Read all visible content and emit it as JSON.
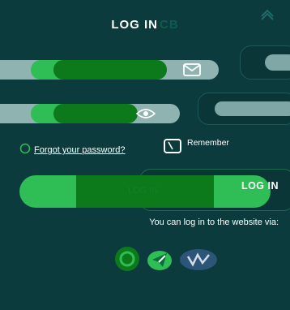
{
  "header": {
    "title": "LOG IN",
    "title_suffix": "CB"
  },
  "form": {
    "username_placeholder": "",
    "password_placeholder": "",
    "forgot_label": "Forgot your password?",
    "remember_label": "Remember",
    "remember_ghost_label": "",
    "login_label": "LOG IN",
    "login_ghost_label": "LOG IN"
  },
  "social": {
    "title": "You can log in to the website via:",
    "ghost_title": "",
    "providers": [
      "steam-icon",
      "telegram-icon",
      "vk-icon"
    ]
  },
  "colors": {
    "background": "#0b3b3c",
    "accent": "#2fbe55",
    "accent_dark": "#0c7a1a",
    "field": "#8fb3b1"
  }
}
